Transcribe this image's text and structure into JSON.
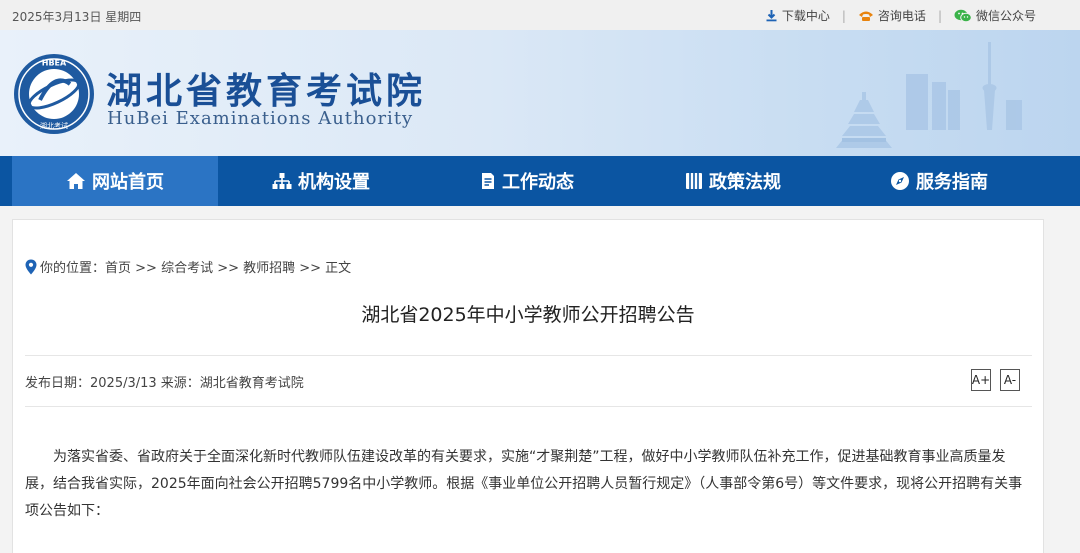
{
  "topbar": {
    "date": "2025年3月13日 星期四",
    "download": "下载中心",
    "hotline": "咨询电话",
    "wechat": "微信公众号",
    "separator": "|"
  },
  "header": {
    "title_cn": "湖北省教育考试院",
    "title_en": "HuBei Examinations Authority",
    "logo_ring_text": "HBEA",
    "logo_sub_text": "湖北考试"
  },
  "nav": {
    "items": [
      {
        "label": "网站首页",
        "icon": "home-icon"
      },
      {
        "label": "机构设置",
        "icon": "org-chart-icon"
      },
      {
        "label": "工作动态",
        "icon": "document-icon"
      },
      {
        "label": "政策法规",
        "icon": "book-icon"
      },
      {
        "label": "服务指南",
        "icon": "compass-icon"
      }
    ]
  },
  "breadcrumb": {
    "prefix": "你的位置：",
    "path": "首页 >> 综合考试 >> 教师招聘 >> 正文"
  },
  "article": {
    "title": "湖北省2025年中小学教师公开招聘公告",
    "meta": "发布日期：2025/3/13 来源：湖北省教育考试院",
    "font_increase": "A+",
    "font_decrease": "A-",
    "paragraph": "为落实省委、省政府关于全面深化新时代教师队伍建设改革的有关要求，实施“才聚荆楚”工程，做好中小学教师队伍补充工作，促进基础教育事业高质量发展，结合我省实际，2025年面向社会公开招聘5799名中小学教师。根据《事业单位公开招聘人员暂行规定》（人事部令第6号）等文件要求，现将公开招聘有关事项公告如下："
  },
  "colors": {
    "nav_bg": "#0b55a2",
    "nav_active": "#2b74c4",
    "title_blue": "#1a4f96",
    "accent_orange": "#e8830e",
    "wechat_green": "#3bb34a"
  }
}
